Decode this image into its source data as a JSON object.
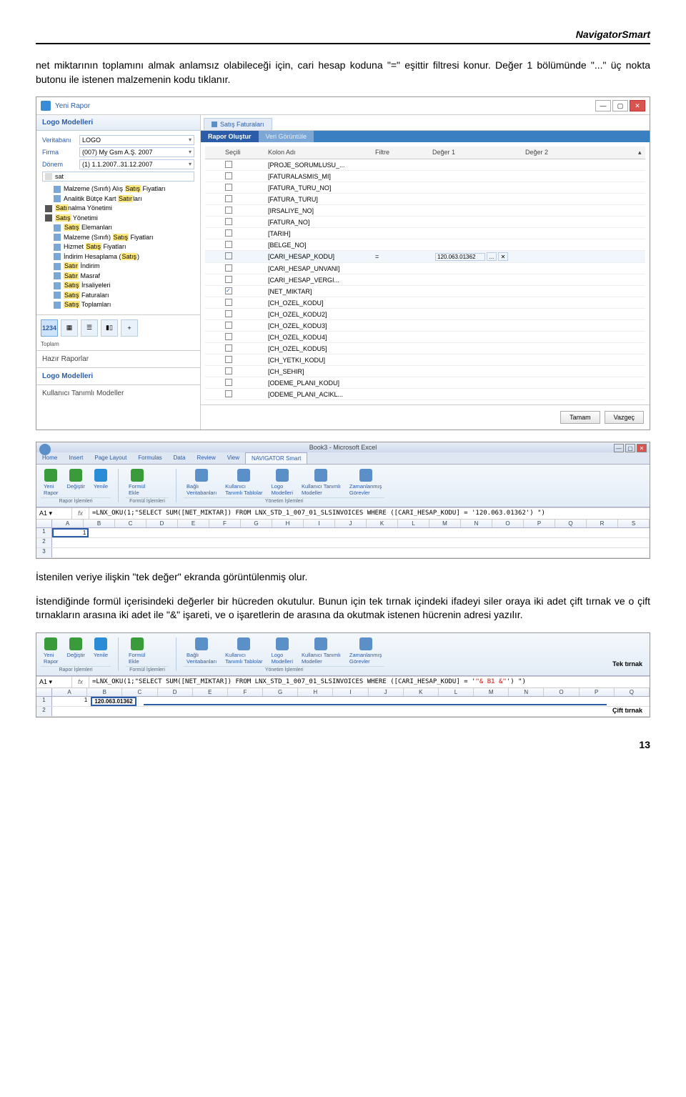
{
  "header": {
    "brand": "NavigatorSmart"
  },
  "para1": "net miktarının toplamını almak anlamsız olabileceği için, cari hesap koduna \"=\" eşittir filtresi konur. Değer 1 bölümünde \"...\" üç nokta butonu ile istenen malzemenin kodu tıklanır.",
  "para2": "İstenilen veriye ilişkin \"tek değer\" ekranda görüntülenmiş olur.",
  "para3": "İstendiğinde formül içerisindeki değerler bir hücreden okutulur. Bunun için tek tırnak içindeki ifadeyi siler oraya iki adet çift tırnak ve o çift tırnakların arasına iki adet ile \"&\" işareti, ve o işaretlerin de arasına da okutmak istenen hücrenin adresi yazılır.",
  "page_num": "13",
  "rapor": {
    "title": "Yeni Rapor",
    "panel_title": "Logo Modelleri",
    "fields": {
      "veritabani_label": "Veritabanı",
      "veritabani_val": "LOGO",
      "firma_label": "Firma",
      "firma_val": "(007) My Gsm A.Ş. 2007",
      "donem_label": "Dönem",
      "donem_val": "(1) 1.1.2007..31.12.2007"
    },
    "filter_text": "sat",
    "tree": [
      {
        "ind": 1,
        "label_pre": "Malzeme (Sınıfı) Alış ",
        "hl": "Satış",
        "label_post": " Fiyatları"
      },
      {
        "ind": 1,
        "label_pre": "Analitik Bütçe Kart ",
        "hl": "Satır",
        "label_post": "ları"
      },
      {
        "ind": 0,
        "folder": true,
        "label_pre": "",
        "hl": "Satı",
        "label_post": "nalma Yönetimi"
      },
      {
        "ind": 0,
        "folder": true,
        "label_pre": "",
        "hl": "Satış",
        "label_post": " Yönetimi"
      },
      {
        "ind": 1,
        "label_pre": "",
        "hl": "Satış",
        "label_post": " Elemanları"
      },
      {
        "ind": 1,
        "label_pre": "Malzeme (Sınıfı) ",
        "hl": "Satış",
        "label_post": " Fiyatları"
      },
      {
        "ind": 1,
        "label_pre": "Hizmet ",
        "hl": "Satış",
        "label_post": " Fiyatları"
      },
      {
        "ind": 1,
        "label_pre": "İndirim Hesaplama (",
        "hl": "Satış",
        "label_post": ")"
      },
      {
        "ind": 1,
        "label_pre": "",
        "hl": "Satır",
        "label_post": " İndirim"
      },
      {
        "ind": 1,
        "label_pre": "",
        "hl": "Satır",
        "label_post": " Masraf"
      },
      {
        "ind": 1,
        "label_pre": "",
        "hl": "Satış",
        "label_post": " İrsaliyeleri"
      },
      {
        "ind": 1,
        "label_pre": "",
        "hl": "Satış",
        "label_post": " Faturaları"
      },
      {
        "ind": 1,
        "label_pre": "",
        "hl": "Satış",
        "label_post": " Toplamları"
      }
    ],
    "toolbar_1234": "1234",
    "toolbar_label": "Toplam",
    "side_sections": [
      "Hazır Raporlar",
      "Logo Modelleri",
      "Kullanıcı Tanımlı Modeller"
    ],
    "main_tab": "Satış Faturaları",
    "sub_tab_active": "Rapor Oluştur",
    "sub_tab_inactive": "Veri Görüntüle",
    "grid_headers": {
      "secili": "Seçili",
      "kolon": "Kolon Adı",
      "filtre": "Filtre",
      "d1": "Değer 1",
      "d2": "Değer 2"
    },
    "rows": [
      {
        "chk": false,
        "name": "[PROJE_SORUMLUSU_..."
      },
      {
        "chk": false,
        "name": "[FATURALASMIS_MI]"
      },
      {
        "chk": false,
        "name": "[FATURA_TURU_NO]"
      },
      {
        "chk": false,
        "name": "[FATURA_TURU]"
      },
      {
        "chk": false,
        "name": "[IRSALIYE_NO]"
      },
      {
        "chk": false,
        "name": "[FATURA_NO]"
      },
      {
        "chk": false,
        "name": "[TARIH]"
      },
      {
        "chk": false,
        "name": "[BELGE_NO]"
      },
      {
        "chk": false,
        "name": "[CARI_HESAP_KODU]",
        "filter": "=",
        "val": "120.063.01362",
        "dots": true,
        "hl": true
      },
      {
        "chk": false,
        "name": "[CARI_HESAP_UNVANI]"
      },
      {
        "chk": false,
        "name": "[CARI_HESAP_VERGI..."
      },
      {
        "chk": true,
        "name": "[NET_MIKTAR]"
      },
      {
        "chk": false,
        "name": "[CH_OZEL_KODU]"
      },
      {
        "chk": false,
        "name": "[CH_OZEL_KODU2]"
      },
      {
        "chk": false,
        "name": "[CH_OZEL_KODU3]"
      },
      {
        "chk": false,
        "name": "[CH_OZEL_KODU4]"
      },
      {
        "chk": false,
        "name": "[CH_OZEL_KODU5]"
      },
      {
        "chk": false,
        "name": "[CH_YETKI_KODU]"
      },
      {
        "chk": false,
        "name": "[CH_SEHIR]"
      },
      {
        "chk": false,
        "name": "[ODEME_PLANI_KODU]"
      },
      {
        "chk": false,
        "name": "[ODEME_PLANI_ACIKL..."
      }
    ],
    "btn_ok": "Tamam",
    "btn_cancel": "Vazgeç"
  },
  "excel": {
    "title": "Book3 - Microsoft Excel",
    "tabs": [
      "Home",
      "Insert",
      "Page Layout",
      "Formulas",
      "Data",
      "Review",
      "View",
      "NAVIGATOR Smart"
    ],
    "active_tab_idx": 7,
    "ribbon": {
      "g1_label": "Rapor İşlemleri",
      "g2_label": "Formül İşlemleri",
      "g3_label": "Yönetim İşlemleri",
      "items": [
        {
          "label": "Yeni\nRapor",
          "type": "plus",
          "color": "#3a9b3a"
        },
        {
          "label": "Değiştir",
          "type": "gear",
          "color": "#3a9b3a"
        },
        {
          "label": "Yenile",
          "type": "refresh",
          "color": "#2a8bd6"
        },
        {
          "sep": true
        },
        {
          "label": "Formül\nEkle",
          "type": "fx",
          "color": "#3a9b3a"
        },
        {
          "sep": true
        },
        {
          "label": "Bağlı\nVeritabanları",
          "type": "db",
          "color": "#5b8fc7"
        },
        {
          "label": "Kullanıcı\nTanımlı Tablolar",
          "type": "table",
          "color": "#5b8fc7"
        },
        {
          "label": "Logo\nModelleri",
          "type": "logo",
          "color": "#5b8fc7"
        },
        {
          "label": "Kullanıcı Tanımlı\nModeller",
          "type": "user",
          "color": "#5b8fc7"
        },
        {
          "label": "Zamanlanmış\nGörevler",
          "type": "clock",
          "color": "#5b8fc7"
        }
      ]
    },
    "cell_ref": "A1",
    "formula1": "=LNX_OKU(1;\"SELECT SUM([NET_MIKTAR]) FROM LNX_STD_1_007_01_SLSINVOICES WHERE ([CARI_HESAP_KODU] = '120.063.01362') \")",
    "cols": [
      "A",
      "B",
      "C",
      "D",
      "E",
      "F",
      "G",
      "H",
      "I",
      "J",
      "K",
      "L",
      "M",
      "N",
      "O",
      "P",
      "Q",
      "R",
      "S"
    ],
    "a1_val": "1"
  },
  "excel2": {
    "formula2_pre": "=LNX_OKU(1;\"SELECT SUM([NET_MIKTAR]) FROM LNX_STD_1_007_01_SLSINVOICES WHERE ([CARI_HESAP_KODU] = '",
    "formula2_amp": "\"& B1 &\"",
    "formula2_post": "') \")",
    "b1_val": "120.063.01362",
    "tek_tirnak": "Tek tırnak",
    "cift_tirnak": "Çift tırnak",
    "cols2": [
      "A",
      "B",
      "C",
      "D",
      "E",
      "F",
      "G",
      "H",
      "I",
      "J",
      "K",
      "L",
      "M",
      "N",
      "O",
      "P",
      "Q"
    ]
  }
}
